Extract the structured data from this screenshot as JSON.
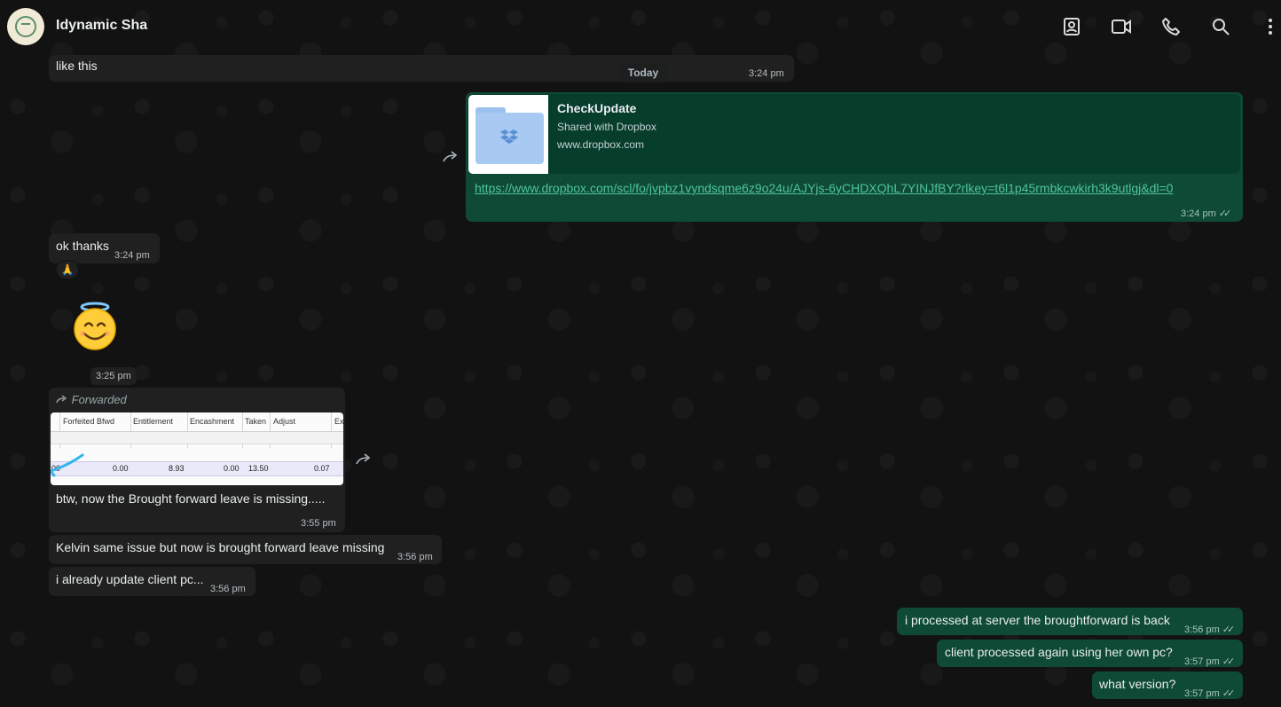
{
  "header": {
    "contact_name": "Idynamic Sha",
    "icons": [
      "contact-card-icon",
      "video-call-icon",
      "voice-call-icon",
      "search-icon",
      "more-menu-icon"
    ]
  },
  "date_divider": "Today",
  "messages": {
    "m1": {
      "text": "like this",
      "time": "3:24 pm"
    },
    "m2": {
      "link_title": "CheckUpdate",
      "link_subtitle": "Shared with Dropbox",
      "link_domain": "www.dropbox.com",
      "url": "https://www.dropbox.com/scl/fo/jvpbz1vyndsqme6z9o24u/AJYjs-6yCHDXQhL7YINJfBY?rlkey=t6l1p45rmbkcwkirh3k9utlgj&dl=0",
      "time": "3:24 pm"
    },
    "m3": {
      "text": "ok thanks",
      "time": "3:24 pm",
      "reaction": "🙏"
    },
    "m4": {
      "time": "3:25 pm"
    },
    "m5": {
      "forwarded_label": "Forwarded",
      "image_table": {
        "columns": [
          "Forfeited Bfwd",
          "Entitlement",
          "Encashment",
          "Taken",
          "Adjust",
          "Ex"
        ],
        "row_values": [
          "00",
          "0.00",
          "8.93",
          "0.00",
          "13.50",
          "0.07"
        ]
      },
      "text": "btw, now the Brought forward leave is missing.....",
      "time": "3:55 pm"
    },
    "m6": {
      "text": "Kelvin same issue but now is brought forward leave missing",
      "time": "3:56 pm"
    },
    "m7": {
      "text": "i already update client pc...",
      "time": "3:56 pm"
    },
    "m8": {
      "text": "i processed at server the broughtforward is back",
      "time": "3:56 pm"
    },
    "m9": {
      "text": "client processed again using her own pc?",
      "time": "3:57 pm"
    },
    "m10": {
      "text": "what version?",
      "time": "3:57 pm"
    }
  },
  "colors": {
    "incoming_bubble": "#202020",
    "outgoing_bubble": "#0e4a35",
    "link_color": "#4fc3a0"
  }
}
